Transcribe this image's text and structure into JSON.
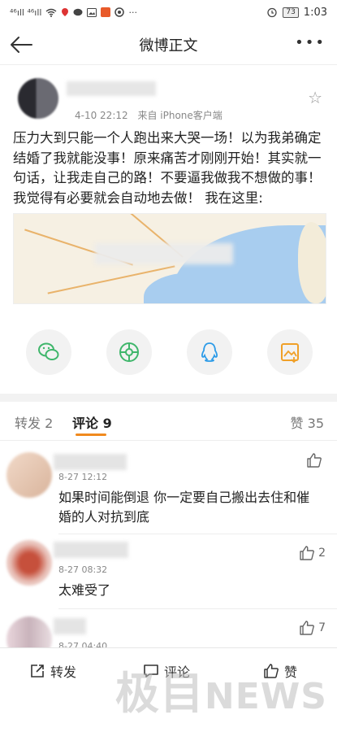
{
  "status_bar": {
    "left_icons": [
      "46-signal-icon",
      "46-signal-icon",
      "wifi-icon",
      "location-icon",
      "chat-icon",
      "image-icon",
      "app-icon",
      "browser-icon",
      "more-icon"
    ],
    "left_text": "⁴⁶ıll ⁴⁶ıll",
    "battery": "73",
    "time": "1:03"
  },
  "nav": {
    "title": "微博正文"
  },
  "post": {
    "date": "4-10 22:12",
    "source": "来自 iPhone客户端",
    "text": "压力大到只能一个人跑出来大哭一场！以为我弟确定结婚了我就能没事！原来痛苦才刚刚开始！其实就一句话，让我走自己的路！不要逼我做我不想做的事！我觉得有必要就会自动地去做！ 我在这里:"
  },
  "share_icons": [
    "wechat-icon",
    "moments-icon",
    "qq-icon",
    "save-image-icon"
  ],
  "tabs": {
    "repost": "转发 2",
    "comment": "评论 9",
    "like": "赞 35"
  },
  "comments": [
    {
      "time": "8-27 12:12",
      "text": "如果时间能倒退 你一定要自己搬出去住和催婚的人对抗到底",
      "likes": ""
    },
    {
      "time": "8-27 08:32",
      "text": "太难受了",
      "likes": "2"
    },
    {
      "time": "8-27 04:40",
      "text": "",
      "likes": "7"
    }
  ],
  "bottom_bar": {
    "repost": "转发",
    "comment": "评论",
    "like": "赞"
  },
  "watermark": {
    "prefix": "极目",
    "suffix": "NEWS"
  },
  "colors": {
    "accent": "#f08a1e",
    "map_sea": "#a8cdef",
    "wechat": "#3fb66b",
    "moments": "#3fb66b",
    "qq": "#2c9be8",
    "save": "#f0a028"
  }
}
